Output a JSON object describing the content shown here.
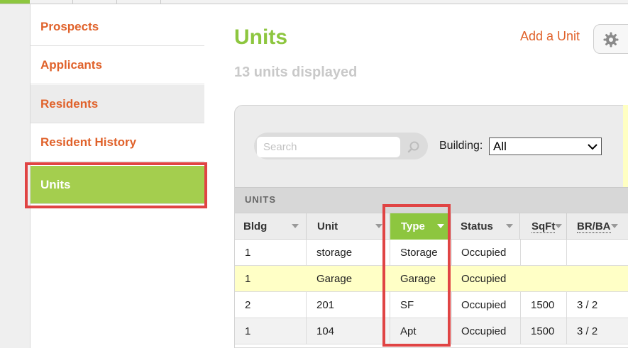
{
  "colors": {
    "accent_orange": "#e0622b",
    "accent_green": "#8dc63f",
    "active_green": "#a4ce4e",
    "highlight_red": "#e04444",
    "row_highlight": "#ffffc6"
  },
  "sidebar": {
    "items": [
      {
        "label": "Prospects"
      },
      {
        "label": "Applicants"
      },
      {
        "label": "Residents"
      },
      {
        "label": "Resident History"
      },
      {
        "label": "Units",
        "active": true
      }
    ]
  },
  "header": {
    "title": "Units",
    "subtitle": "13 units displayed",
    "add_unit": "Add a Unit",
    "settings_icon": "gear-icon"
  },
  "filters": {
    "search_placeholder": "Search",
    "building_label": "Building:",
    "building_value": "All"
  },
  "table": {
    "section_label": "UNITS",
    "columns": [
      "Bldg",
      "Unit",
      "Type",
      "Status",
      "SqFt",
      "BR/BA"
    ],
    "sorted_column": "Type",
    "rows": [
      {
        "bldg": "1",
        "unit": "storage",
        "type": "Storage",
        "status": "Occupied",
        "sqft": "",
        "brba": ""
      },
      {
        "bldg": "1",
        "unit": "Garage",
        "type": "Garage",
        "status": "Occupied",
        "sqft": "",
        "brba": ""
      },
      {
        "bldg": "2",
        "unit": "201",
        "type": "SF",
        "status": "Occupied",
        "sqft": "1500",
        "brba": "3 / 2"
      },
      {
        "bldg": "1",
        "unit": "104",
        "type": "Apt",
        "status": "Occupied",
        "sqft": "1500",
        "brba": "3 / 2"
      }
    ]
  }
}
